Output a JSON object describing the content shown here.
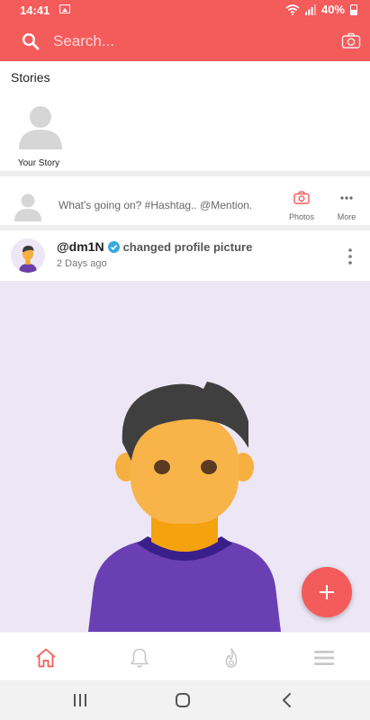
{
  "status_bar": {
    "time": "14:41",
    "battery": "40%"
  },
  "search": {
    "placeholder": "Search..."
  },
  "stories": {
    "title": "Stories",
    "items": [
      {
        "label": "Your Story"
      }
    ]
  },
  "composer": {
    "placeholder": "What's going on? #Hashtag.. @Mention.",
    "photos_label": "Photos",
    "more_label": "More"
  },
  "post": {
    "username": "@dm1N",
    "action": "changed profile picture",
    "time": "2 Days ago"
  },
  "colors": {
    "accent": "#f45b5b",
    "image_bg": "#ece6f5",
    "verified": "#3aa8e0"
  },
  "icons": {
    "search": "search-icon",
    "camera": "camera-icon",
    "home": "home-icon",
    "notifications": "bell-icon",
    "trending": "flame-icon",
    "menu": "hamburger-icon",
    "add": "plus-icon"
  }
}
